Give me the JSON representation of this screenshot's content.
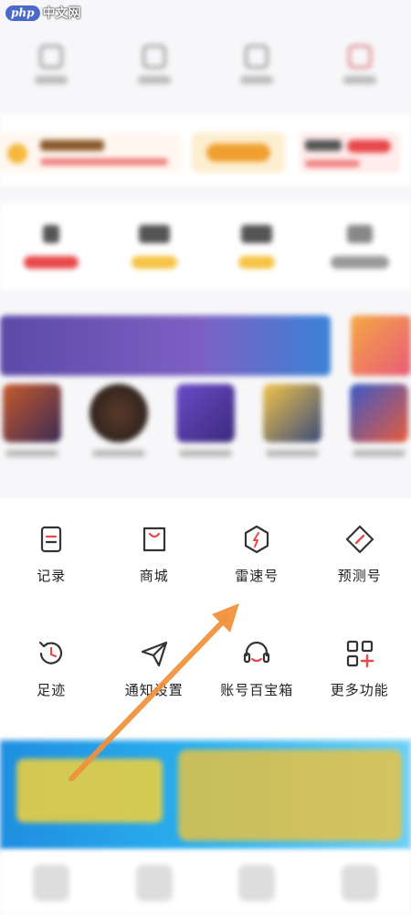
{
  "watermark": {
    "badge": "php",
    "site": "中文网"
  },
  "functions": {
    "items": [
      {
        "label": "记录",
        "icon": "record-icon"
      },
      {
        "label": "商城",
        "icon": "shop-bag-icon"
      },
      {
        "label": "雷速号",
        "icon": "leisu-hexagon-icon"
      },
      {
        "label": "预测号",
        "icon": "prediction-compass-icon"
      },
      {
        "label": "足迹",
        "icon": "history-clock-icon"
      },
      {
        "label": "通知设置",
        "icon": "notification-send-icon"
      },
      {
        "label": "账号百宝箱",
        "icon": "headset-service-icon"
      },
      {
        "label": "更多功能",
        "icon": "more-grid-icon"
      }
    ]
  },
  "colors": {
    "icon_stroke": "#333333",
    "accent_red": "#e8484a",
    "arrow": "#f0913c"
  }
}
